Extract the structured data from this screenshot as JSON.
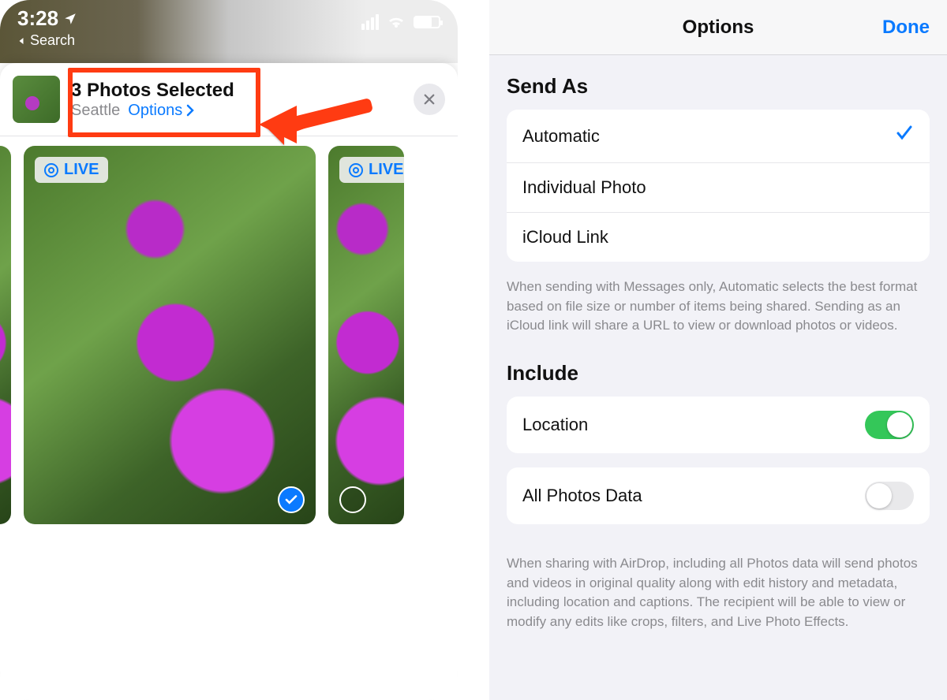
{
  "left": {
    "status": {
      "time": "3:28",
      "back_label": "Search"
    },
    "header": {
      "title": "3 Photos Selected",
      "location": "Seattle",
      "options_label": "Options"
    },
    "live_badge": "LIVE",
    "photos": {
      "center_selected": true
    }
  },
  "right": {
    "nav": {
      "title": "Options",
      "done": "Done"
    },
    "send_as": {
      "title": "Send As",
      "items": [
        "Automatic",
        "Individual Photo",
        "iCloud Link"
      ],
      "selected_index": 0,
      "footer": "When sending with Messages only, Automatic selects the best format based on file size or number of items being shared. Sending as an iCloud link will share a URL to view or download photos or videos."
    },
    "include": {
      "title": "Include",
      "location_label": "Location",
      "location_on": true,
      "allphotos_label": "All Photos Data",
      "allphotos_on": false,
      "footer": "When sharing with AirDrop, including all Photos data will send photos and videos in original quality along with edit history and metadata, including location and captions. The recipient will be able to view or modify any edits like crops, filters, and Live Photo Effects."
    }
  }
}
